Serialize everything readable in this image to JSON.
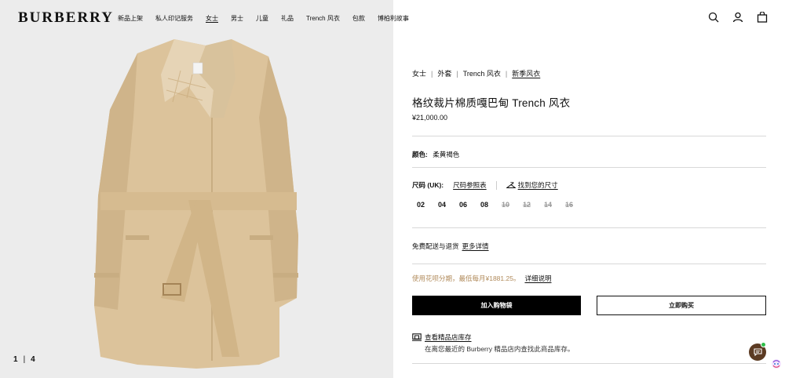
{
  "header": {
    "logo": "BURBERRY",
    "nav": [
      {
        "label": "新品上架",
        "active": false
      },
      {
        "label": "私人印记服务",
        "active": false
      },
      {
        "label": "女士",
        "active": true
      },
      {
        "label": "男士",
        "active": false
      },
      {
        "label": "儿童",
        "active": false
      },
      {
        "label": "礼品",
        "active": false
      },
      {
        "label": "Trench 风衣",
        "active": false
      },
      {
        "label": "包款",
        "active": false
      },
      {
        "label": "博柏利故事",
        "active": false
      }
    ],
    "icons": [
      "search-icon",
      "account-icon",
      "bag-icon"
    ]
  },
  "gallery": {
    "current": "1",
    "separator": "|",
    "total": "4"
  },
  "product": {
    "breadcrumb": [
      "女士",
      "外套",
      "Trench 风衣",
      "新季风衣"
    ],
    "title": "格纹裁片棉质嘎巴甸 Trench 风衣",
    "price": "¥21,000.00",
    "color_label": "颜色:",
    "color_value": "柔黄褐色",
    "size_label": "尺码 (UK):",
    "size_chart_link": "尺码参照表",
    "find_size_link": "找到您的尺寸",
    "sizes": [
      {
        "label": "02",
        "available": true
      },
      {
        "label": "04",
        "available": true
      },
      {
        "label": "06",
        "available": true
      },
      {
        "label": "08",
        "available": true
      },
      {
        "label": "10",
        "available": false
      },
      {
        "label": "12",
        "available": false
      },
      {
        "label": "14",
        "available": false
      },
      {
        "label": "16",
        "available": false
      }
    ],
    "shipping_text": "免费配送与退货",
    "shipping_link": "更多详情",
    "installment_text": "使用花呗分期，最低每月¥1881.25。",
    "installment_link": "详细说明",
    "add_to_bag": "加入购物袋",
    "buy_now": "立即购买",
    "store_link": "查看精品店库存",
    "store_desc": "在离您最近的 Burberry 精品店内查找此商品库存。"
  },
  "colors": {
    "image_bg": "#ececec",
    "coat": "#dcc39b",
    "installment_text": "#b08a5a",
    "chat": "#5c3b23",
    "online_dot": "#2fbf4a"
  }
}
